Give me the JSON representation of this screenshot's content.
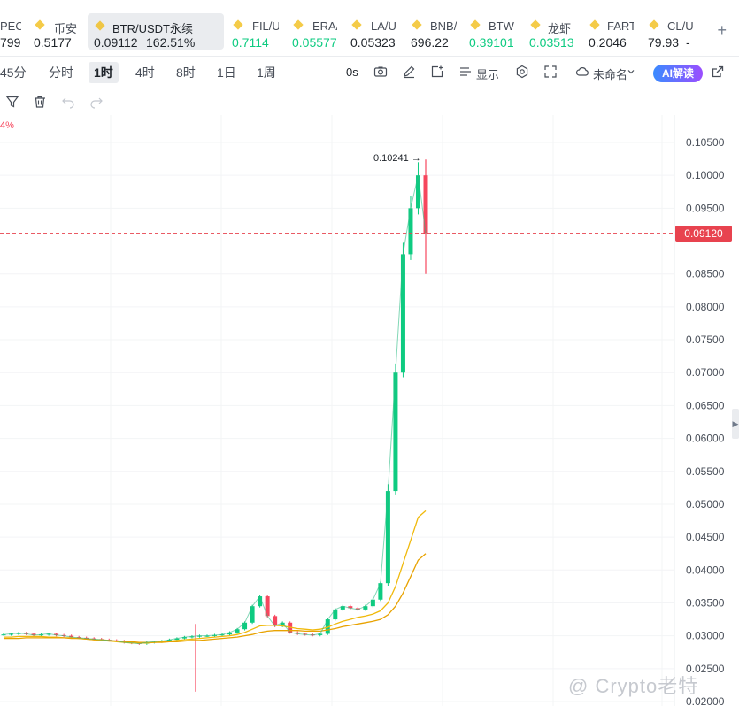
{
  "tickers": [
    {
      "name": "PEOF",
      "price": "799",
      "price_color": "#1e2329"
    },
    {
      "name": "币安",
      "price": "0.5177",
      "price_color": "#1e2329"
    },
    {
      "name": "BTR/USDT永续",
      "price": "0.09112",
      "change": "162.51%",
      "price_color": "#1e2329"
    },
    {
      "name": "FIL/U",
      "price": "0.7114",
      "price_color": "#0ecb81"
    },
    {
      "name": "ERA/",
      "price": "0.05577",
      "price_color": "#0ecb81"
    },
    {
      "name": "LA/U",
      "price": "0.05323",
      "price_color": "#1e2329"
    },
    {
      "name": "BNB/",
      "price": "696.22",
      "price_color": "#1e2329"
    },
    {
      "name": "BTW",
      "price": "0.39101",
      "price_color": "#0ecb81"
    },
    {
      "name": "龙虾",
      "price": "0.03513",
      "price_color": "#0ecb81"
    },
    {
      "name": "FART",
      "price": "0.2046",
      "price_color": "#1e2329"
    },
    {
      "name": "CL/U",
      "price": "79.93",
      "change": "-",
      "price_color": "#1e2329"
    }
  ],
  "add_label": "+",
  "intervals": [
    "45分",
    "分时",
    "1时",
    "4时",
    "8时",
    "1日",
    "1周"
  ],
  "active_interval": "1时",
  "toolbar": {
    "countdown": "0s",
    "indicators_label": "显示",
    "layout_name": "未命名",
    "ai_label": "AI解读"
  },
  "chart": {
    "change_badge": "4%",
    "last_price_tag": "0.09120",
    "high_marker": "0.10241 →",
    "watermark": "@ Crypto老特",
    "colors": {
      "up": "#0ecb81",
      "down": "#f6465d",
      "ma_fast": "#f0b90b",
      "ma_slow": "#e8a200",
      "last_line": "#e8434f"
    }
  },
  "chart_data": {
    "type": "line",
    "title": "",
    "y_axis_ticks": [
      "0.10500",
      "0.10000",
      "0.09500",
      "0.09120",
      "0.08500",
      "0.08000",
      "0.07500",
      "0.07000",
      "0.06500",
      "0.06000",
      "0.05500",
      "0.05000",
      "0.04500",
      "0.04000",
      "0.03500",
      "0.03000",
      "0.02500",
      "0.02000"
    ],
    "ylim": [
      0.02,
      0.106
    ],
    "last_price": 0.0912,
    "high": 0.10241,
    "close_series": [
      0.0302,
      0.0303,
      0.0304,
      0.0303,
      0.0301,
      0.0302,
      0.0303,
      0.0301,
      0.03,
      0.0298,
      0.0297,
      0.0296,
      0.0295,
      0.0294,
      0.0293,
      0.0292,
      0.029,
      0.0289,
      0.0288,
      0.029,
      0.0291,
      0.0292,
      0.0294,
      0.0296,
      0.0298,
      0.0299,
      0.03,
      0.03,
      0.0301,
      0.0302,
      0.0305,
      0.031,
      0.032,
      0.0345,
      0.036,
      0.033,
      0.0315,
      0.032,
      0.0305,
      0.0303,
      0.0302,
      0.0301,
      0.0303,
      0.0325,
      0.034,
      0.0345,
      0.0342,
      0.034,
      0.0345,
      0.0355,
      0.038,
      0.052,
      0.07,
      0.088,
      0.095,
      0.1,
      0.0912
    ],
    "ma_fast": [
      0.0298,
      0.0298,
      0.0299,
      0.0299,
      0.0299,
      0.0299,
      0.0298,
      0.0298,
      0.0297,
      0.0297,
      0.0296,
      0.0295,
      0.0294,
      0.0293,
      0.0292,
      0.0291,
      0.029,
      0.0289,
      0.0289,
      0.0289,
      0.029,
      0.0291,
      0.0292,
      0.0293,
      0.0294,
      0.0295,
      0.0296,
      0.0297,
      0.0298,
      0.0299,
      0.03,
      0.0302,
      0.0305,
      0.031,
      0.0315,
      0.0316,
      0.0316,
      0.0315,
      0.0313,
      0.0311,
      0.031,
      0.0309,
      0.031,
      0.0313,
      0.0318,
      0.0322,
      0.0325,
      0.0328,
      0.033,
      0.0333,
      0.0338,
      0.035,
      0.0375,
      0.041,
      0.0445,
      0.048,
      0.049
    ],
    "ma_slow": [
      0.0296,
      0.0296,
      0.0296,
      0.0297,
      0.0297,
      0.0297,
      0.0297,
      0.0297,
      0.0297,
      0.0296,
      0.0296,
      0.0295,
      0.0294,
      0.0294,
      0.0293,
      0.0292,
      0.0291,
      0.0291,
      0.029,
      0.029,
      0.029,
      0.029,
      0.0291,
      0.0291,
      0.0292,
      0.0293,
      0.0293,
      0.0294,
      0.0295,
      0.0296,
      0.0297,
      0.0298,
      0.03,
      0.0302,
      0.0305,
      0.0307,
      0.0308,
      0.0308,
      0.0308,
      0.0308,
      0.0307,
      0.0307,
      0.0307,
      0.0309,
      0.0311,
      0.0314,
      0.0316,
      0.0318,
      0.032,
      0.0322,
      0.0325,
      0.0332,
      0.0345,
      0.0365,
      0.039,
      0.0415,
      0.0425
    ],
    "grid": true
  }
}
